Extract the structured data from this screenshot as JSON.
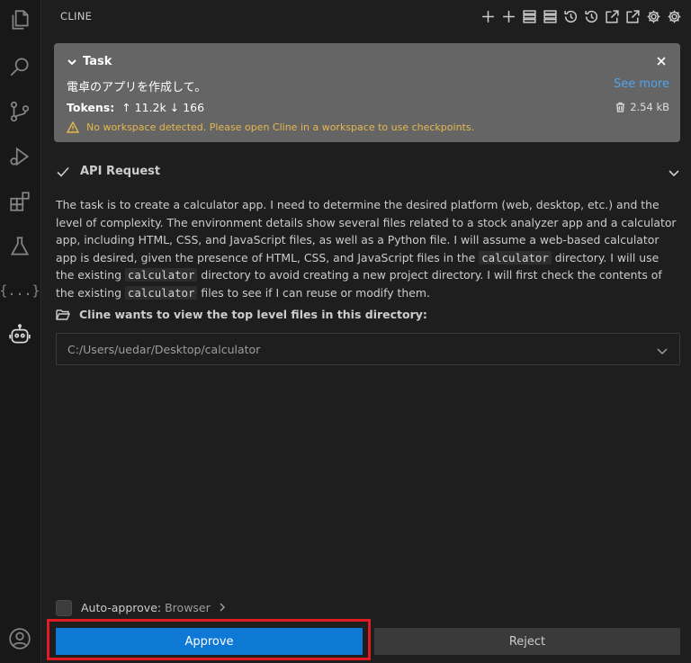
{
  "panel": {
    "title": "CLINE"
  },
  "task": {
    "label": "Task",
    "text": "電卓のアプリを作成して。",
    "see_more": "See more",
    "tokens_label": "Tokens:",
    "tokens_up": "↑ 11.2k",
    "tokens_down": "↓ 166",
    "size": "2.54 kB",
    "warning": "No workspace detected. Please open Cline in a workspace to use checkpoints."
  },
  "api_request": {
    "label": "API Request"
  },
  "message": {
    "part1": "The task is to create a calculator app.  I need to determine the desired platform (web, desktop, etc.) and the level of complexity.  The environment details show several files related to a stock analyzer app and a calculator app, including HTML, CSS, and JavaScript files, as well as a Python file.  I will assume a web-based calculator app is desired, given the presence of HTML, CSS, and JavaScript files in the ",
    "code1": "calculator",
    "part2": " directory.  I will use the existing ",
    "code2": "calculator",
    "part3": " directory to avoid creating a new project directory.  I will first check the contents of the existing ",
    "code3": "calculator",
    "part4": " files to see if I can reuse or modify them."
  },
  "view_files": {
    "label": "Cline wants to view the top level files in this directory:",
    "path": "C:/Users/uedar/Desktop/calculator"
  },
  "auto_approve": {
    "label": "Auto-approve:",
    "value": "Browser"
  },
  "actions": {
    "approve": "Approve",
    "reject": "Reject"
  },
  "colors": {
    "accent": "#0e78d5",
    "highlight": "#e01b24",
    "warning": "#e5b84d",
    "link": "#4fa3f0"
  }
}
